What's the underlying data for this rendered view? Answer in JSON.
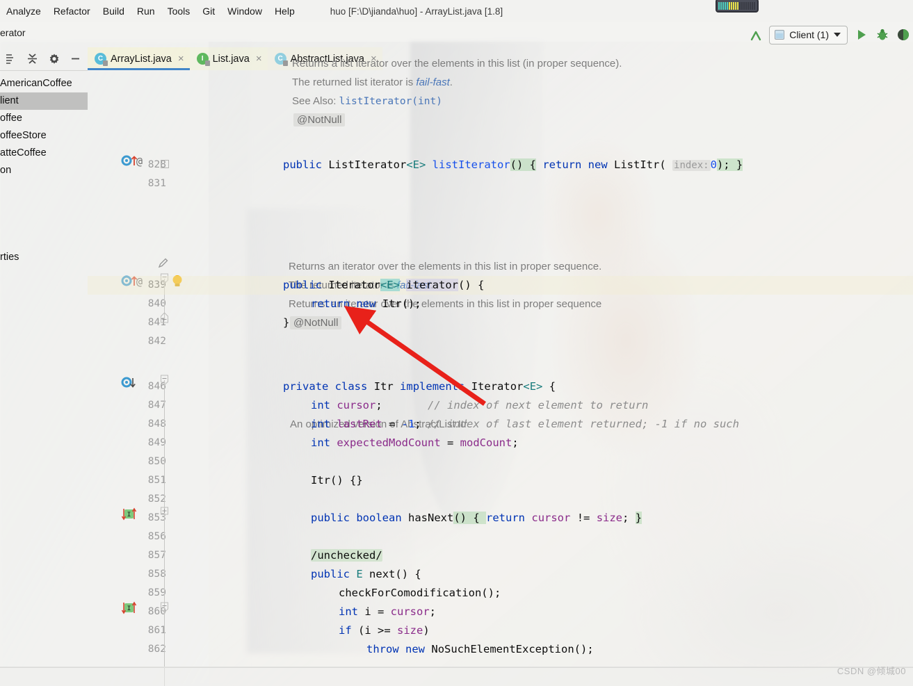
{
  "window": {
    "title": "huo [F:\\D\\jianda\\huo] - ArrayList.java [1.8]"
  },
  "menubar": {
    "items": [
      {
        "label": "Analyze"
      },
      {
        "label": "Refactor"
      },
      {
        "label": "Build"
      },
      {
        "label": "Run"
      },
      {
        "label": "Tools"
      },
      {
        "label": "Git"
      },
      {
        "label": "Window"
      },
      {
        "label": "Help"
      }
    ]
  },
  "toolbar": {
    "breadcrumb": "erator",
    "run_config": "Client (1)",
    "icons": {
      "build": "build-hammer-icon",
      "run": "run-icon",
      "debug": "debug-icon",
      "coverage": "run-with-coverage-icon"
    }
  },
  "left_panel": {
    "toolbar_icons": [
      "expand-all-icon",
      "collapse-all-icon",
      "settings-gear-icon",
      "hide-panel-icon"
    ],
    "tree": [
      {
        "label": "AmericanCoffee",
        "selected": false
      },
      {
        "label": "lient",
        "selected": true
      },
      {
        "label": "offee",
        "selected": false
      },
      {
        "label": "offeeStore",
        "selected": false
      },
      {
        "label": "atteCoffee",
        "selected": false
      },
      {
        "label": "on",
        "selected": false
      },
      {
        "label": "rties",
        "selected": false
      }
    ]
  },
  "editor": {
    "tabs": [
      {
        "label": "ArrayList.java",
        "icon": "class-icon",
        "icon_letter": "C",
        "active": true
      },
      {
        "label": "List.java",
        "icon": "interface-icon",
        "icon_letter": "I",
        "active": false
      },
      {
        "label": "AbstractList.java",
        "icon": "class-icon",
        "icon_letter": "C",
        "active": false
      }
    ],
    "close_glyph": "×",
    "line_numbers": [
      "828",
      "831",
      "839",
      "840",
      "841",
      "842",
      "846",
      "847",
      "848",
      "849",
      "850",
      "851",
      "852",
      "853",
      "856",
      "857",
      "858",
      "859",
      "860",
      "861",
      "862"
    ],
    "doc_blocks": {
      "d1_line1": "Returns a list iterator over the elements in this list (in proper sequence).",
      "d1_line2_pre": "The returned list iterator is ",
      "d1_line2_em": "fail-fast",
      "d1_line2_post": ".",
      "d1_line3_label": "See Also: ",
      "d1_line3_link": "listIterator(int)",
      "d2_line1": "Returns an iterator over the elements in this list in proper sequence.",
      "d2_line2_pre": "The returned iterator is ",
      "d2_line2_em": "fail-fast",
      "d2_line2_post": ".",
      "d2_line3": "Returns: an iterator over the elements in this list in proper sequence",
      "d3_line1": "An optimized version of AbstractList.Itr"
    },
    "annotations": {
      "a1": "@NotNull",
      "a2": "@NotNull"
    },
    "code": {
      "l828": {
        "kw1": "public",
        "type": "ListIterator",
        "gen": "<E>",
        "mname": " listIterator",
        "p1": "() {",
        "kw2": "return",
        "kw3": "new",
        "ctor": "ListItr",
        "hint": "index:",
        "num": "0",
        "tail": "); }"
      },
      "l839": {
        "kw1": "public",
        "type": "Iterator",
        "gen": "<E>",
        "mname": "iterator",
        "tail": "() {"
      },
      "l840": {
        "kw1": "return",
        "kw2": "new",
        "ctor": "Itr",
        "tail": "();"
      },
      "l841": {
        "text": "}"
      },
      "l846": {
        "kw1": "private",
        "kw2": "class",
        "cname": "Itr",
        "kw3": "implements",
        "iface": "Iterator",
        "gen": "<E>",
        "tail": " {"
      },
      "l847": {
        "kw": "int",
        "fld": "cursor",
        "semi": ";",
        "cmt": "// index of next element to return"
      },
      "l848": {
        "kw": "int",
        "fld": "lastRet",
        "eq": " = ",
        "num": "-1",
        "semi": ";",
        "cmt": "// index of last element returned; -1 if no such"
      },
      "l849": {
        "kw": "int",
        "fld": "expectedModCount",
        "eq": " = ",
        "fld2": "modCount",
        "semi": ";"
      },
      "l851": {
        "text": "Itr() {}"
      },
      "l853": {
        "kw1": "public",
        "kw2": "boolean",
        "mname": "hasNext",
        "open": "() { ",
        "kw3": "return",
        "fld": "cursor",
        "op": " != ",
        "fld2": "size",
        "semi": "; ",
        "close": "}"
      },
      "l857": {
        "folded": "/unchecked/"
      },
      "l858": {
        "kw1": "public",
        "gen": "E",
        "mname": "next",
        "tail": "() {"
      },
      "l859": {
        "text": "checkForComodification();"
      },
      "l860": {
        "kw": "int",
        "var": " i = ",
        "fld": "cursor",
        "semi": ";"
      },
      "l861": {
        "kw": "if",
        "expr": " (i >= ",
        "fld": "size",
        "tail": ")"
      },
      "l862": {
        "kw1": "throw",
        "kw2": "new",
        "exc": "NoSuchElementException",
        "tail": "();"
      }
    }
  },
  "watermark": {
    "text": "CSDN @倾城00"
  },
  "colors": {
    "accent_blue": "#4286c9",
    "keyword": "#0033b3",
    "field": "#8a2b8a",
    "comment": "#8c8c8c",
    "number": "#1750eb",
    "run_green": "#4fa04f",
    "arrow_red": "#e8211a"
  }
}
